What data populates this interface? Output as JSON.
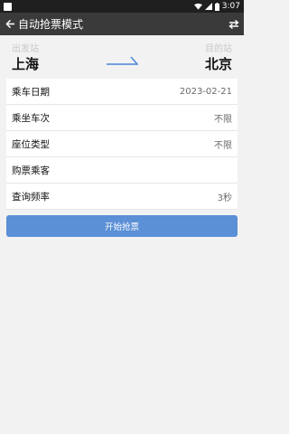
{
  "status_bar": {
    "time": "3:07"
  },
  "app_bar": {
    "title": "自动抢票模式"
  },
  "route": {
    "from_label": "出发站",
    "from_city": "上海",
    "to_label": "目的站",
    "to_city": "北京"
  },
  "form": {
    "rows": [
      {
        "key": "乘车日期",
        "value": "2023-02-21"
      },
      {
        "key": "乘坐车次",
        "value": "不限"
      },
      {
        "key": "座位类型",
        "value": "不限"
      },
      {
        "key": "购票乘客",
        "value": ""
      },
      {
        "key": "查询频率",
        "value": "3秒"
      }
    ]
  },
  "actions": {
    "start_label": "开始抢票"
  },
  "colors": {
    "accent": "#5b8fd6",
    "app_bar": "#3a3a3a",
    "status_bar": "#1f1f1f"
  }
}
